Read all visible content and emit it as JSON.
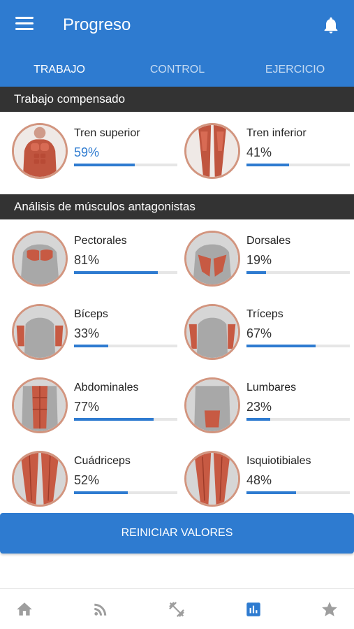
{
  "app": {
    "title": "Progreso"
  },
  "tabs": [
    {
      "label": "TRABAJO",
      "active": true
    },
    {
      "label": "CONTROL",
      "active": false
    },
    {
      "label": "EJERCICIO",
      "active": false
    }
  ],
  "sections": {
    "compensated": {
      "title": "Trabajo compensado",
      "items": [
        {
          "label": "Tren superior",
          "value": "59%",
          "progress": 0.59,
          "icon": "upper-body-muscles-icon"
        },
        {
          "label": "Tren inferior",
          "value": "41%",
          "progress": 0.41,
          "icon": "lower-body-muscles-icon"
        }
      ]
    },
    "antagonists": {
      "title": "Análisis de músculos antagonistas",
      "items": [
        {
          "label": "Pectorales",
          "value": "81%",
          "progress": 0.81,
          "icon": "pectorals-icon"
        },
        {
          "label": "Dorsales",
          "value": "19%",
          "progress": 0.19,
          "icon": "dorsals-icon"
        },
        {
          "label": "Bíceps",
          "value": "33%",
          "progress": 0.33,
          "icon": "biceps-icon"
        },
        {
          "label": "Tríceps",
          "value": "67%",
          "progress": 0.67,
          "icon": "triceps-icon"
        },
        {
          "label": "Abdominales",
          "value": "77%",
          "progress": 0.77,
          "icon": "abdominals-icon"
        },
        {
          "label": "Lumbares",
          "value": "23%",
          "progress": 0.23,
          "icon": "lumbar-icon"
        },
        {
          "label": "Cuádriceps",
          "value": "52%",
          "progress": 0.52,
          "icon": "quadriceps-icon"
        },
        {
          "label": "Isquiotibiales",
          "value": "48%",
          "progress": 0.48,
          "icon": "hamstrings-icon"
        }
      ]
    }
  },
  "reset_button": {
    "label": "REINICIAR VALORES"
  },
  "bottom_nav": [
    {
      "icon": "home-icon",
      "active": false
    },
    {
      "icon": "feed-icon",
      "active": false
    },
    {
      "icon": "exercise-icon",
      "active": false
    },
    {
      "icon": "stats-icon",
      "active": true
    },
    {
      "icon": "star-icon",
      "active": false
    }
  ],
  "colors": {
    "primary": "#2e7bd0",
    "section_header": "#333333",
    "thumb_border": "#d2957f",
    "inactive_icon": "#9e9e9e"
  }
}
